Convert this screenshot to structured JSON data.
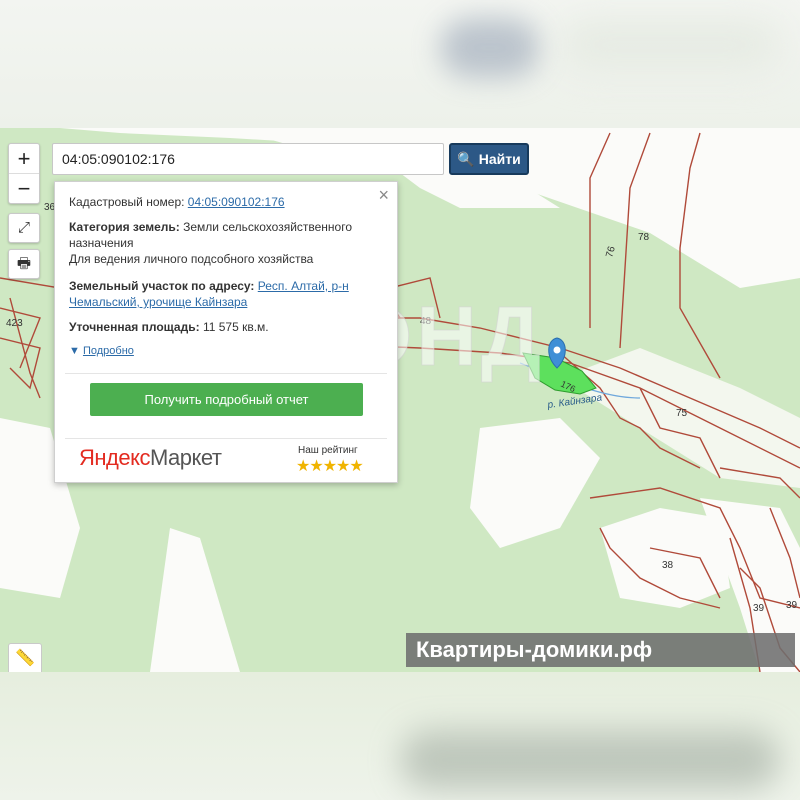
{
  "search": {
    "value": "04:05:090102:176",
    "button_label": "Найти"
  },
  "controls": {
    "zoom_in": "+",
    "zoom_out": "−",
    "fullscreen_icon": "expand-icon",
    "print_icon": "print-icon",
    "ruler_icon": "ruler-icon"
  },
  "popup": {
    "close": "×",
    "cadastral_label": "Кадастровый номер:",
    "cadastral_value": "04:05:090102:176",
    "category_label": "Категория земель:",
    "category_value_1": "Земли сельскохозяйственного",
    "category_value_2": "назначения",
    "category_value_3": "Для ведения личного подсобного хозяйства",
    "address_label": "Земельный участок по адресу:",
    "address_value_1": "Респ. Алтай, р-н",
    "address_value_2": "Чемальский, урочище Кайнзара",
    "area_label": "Уточненная площадь:",
    "area_value": "11 575 кв.м.",
    "more_link": "Подробно",
    "report_button": "Получить подробный отчет",
    "market_brand_1": "Яндекс",
    "market_brand_2": "Маркет",
    "rating_label": "Наш рейтинг",
    "rating_stars": "★★★★★",
    "rating_value": 5
  },
  "map": {
    "labels": {
      "l36": "36",
      "l423": "423",
      "l48": "48",
      "l76": "76",
      "l78": "78",
      "l176": "176",
      "l75": "75",
      "l38": "38",
      "l39a": "39",
      "l39b": "39",
      "river": "р. Кайнзара"
    }
  },
  "watermarks": {
    "big": "ЖИЛФОНД",
    "banner": "Квартиры-домики.рф"
  },
  "colors": {
    "parcel_border": "#b04a3a",
    "forest": "#cfe8c3",
    "highlight": "#5de05d",
    "button_blue": "#2c5886",
    "report_green": "#4caf50"
  }
}
